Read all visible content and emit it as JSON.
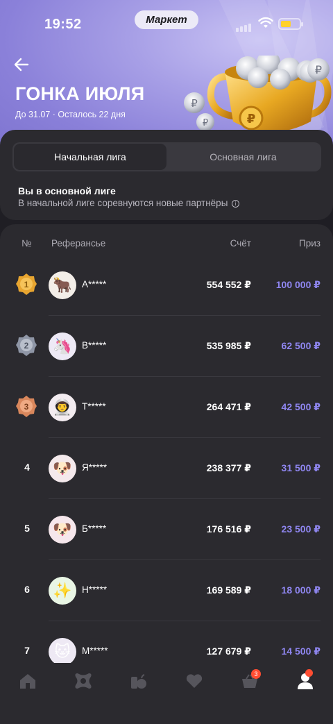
{
  "status_bar": {
    "time": "19:52",
    "app_badge": "Маркет"
  },
  "header": {
    "title": "ГОНКА ИЮЛЯ",
    "subtitle": "До 31.07 · Осталось 22 дня"
  },
  "leagues": {
    "tabs": [
      {
        "label": "Начальная лига",
        "active": true
      },
      {
        "label": "Основная лига",
        "active": false
      }
    ],
    "info_title": "Вы в основной лиге",
    "info_text": "В начальной лиге соревнуются новые партнёры",
    "info_icon": "i"
  },
  "table": {
    "headers": {
      "rank": "№",
      "name": "Реферансье",
      "score": "Счёт",
      "prize": "Приз"
    },
    "rows": [
      {
        "rank": "1",
        "medal": "gold",
        "avatar": "ox-icon",
        "avatar_glyph": "🐂",
        "name": "А*****",
        "score": "554 552 ₽",
        "prize": "100 000 ₽"
      },
      {
        "rank": "2",
        "medal": "silver",
        "avatar": "unicorn-icon",
        "avatar_glyph": "🦄",
        "name": "В*****",
        "score": "535 985 ₽",
        "prize": "62 500 ₽"
      },
      {
        "rank": "3",
        "medal": "bronze",
        "avatar": "astronaut-icon",
        "avatar_glyph": "👨‍🚀",
        "name": "Т*****",
        "score": "264 471 ₽",
        "prize": "42 500 ₽"
      },
      {
        "rank": "4",
        "medal": null,
        "avatar": "dog-icon",
        "avatar_glyph": "🐶",
        "name": "Я*****",
        "score": "238 377 ₽",
        "prize": "31 500 ₽"
      },
      {
        "rank": "5",
        "medal": null,
        "avatar": "dog-icon",
        "avatar_glyph": "🐶",
        "name": "Б*****",
        "score": "176 516 ₽",
        "prize": "23 500 ₽"
      },
      {
        "rank": "6",
        "medal": null,
        "avatar": "sparkles-icon",
        "avatar_glyph": "✨",
        "name": "Н*****",
        "score": "169 589 ₽",
        "prize": "18 000 ₽"
      },
      {
        "rank": "7",
        "medal": null,
        "avatar": "cat-icon",
        "avatar_glyph": "🐱",
        "name": "М*****",
        "score": "127 679 ₽",
        "prize": "14 500 ₽"
      }
    ]
  },
  "bottom_nav": {
    "items": [
      "home-icon",
      "catalog-icon",
      "groceries-icon",
      "favorites-icon",
      "cart-icon",
      "profile-icon"
    ],
    "cart_badge": "3"
  },
  "colors": {
    "accent": "#8f86f0",
    "hero": "#9a92e2",
    "card": "#2b2a2f",
    "badge": "#ff4d32"
  }
}
